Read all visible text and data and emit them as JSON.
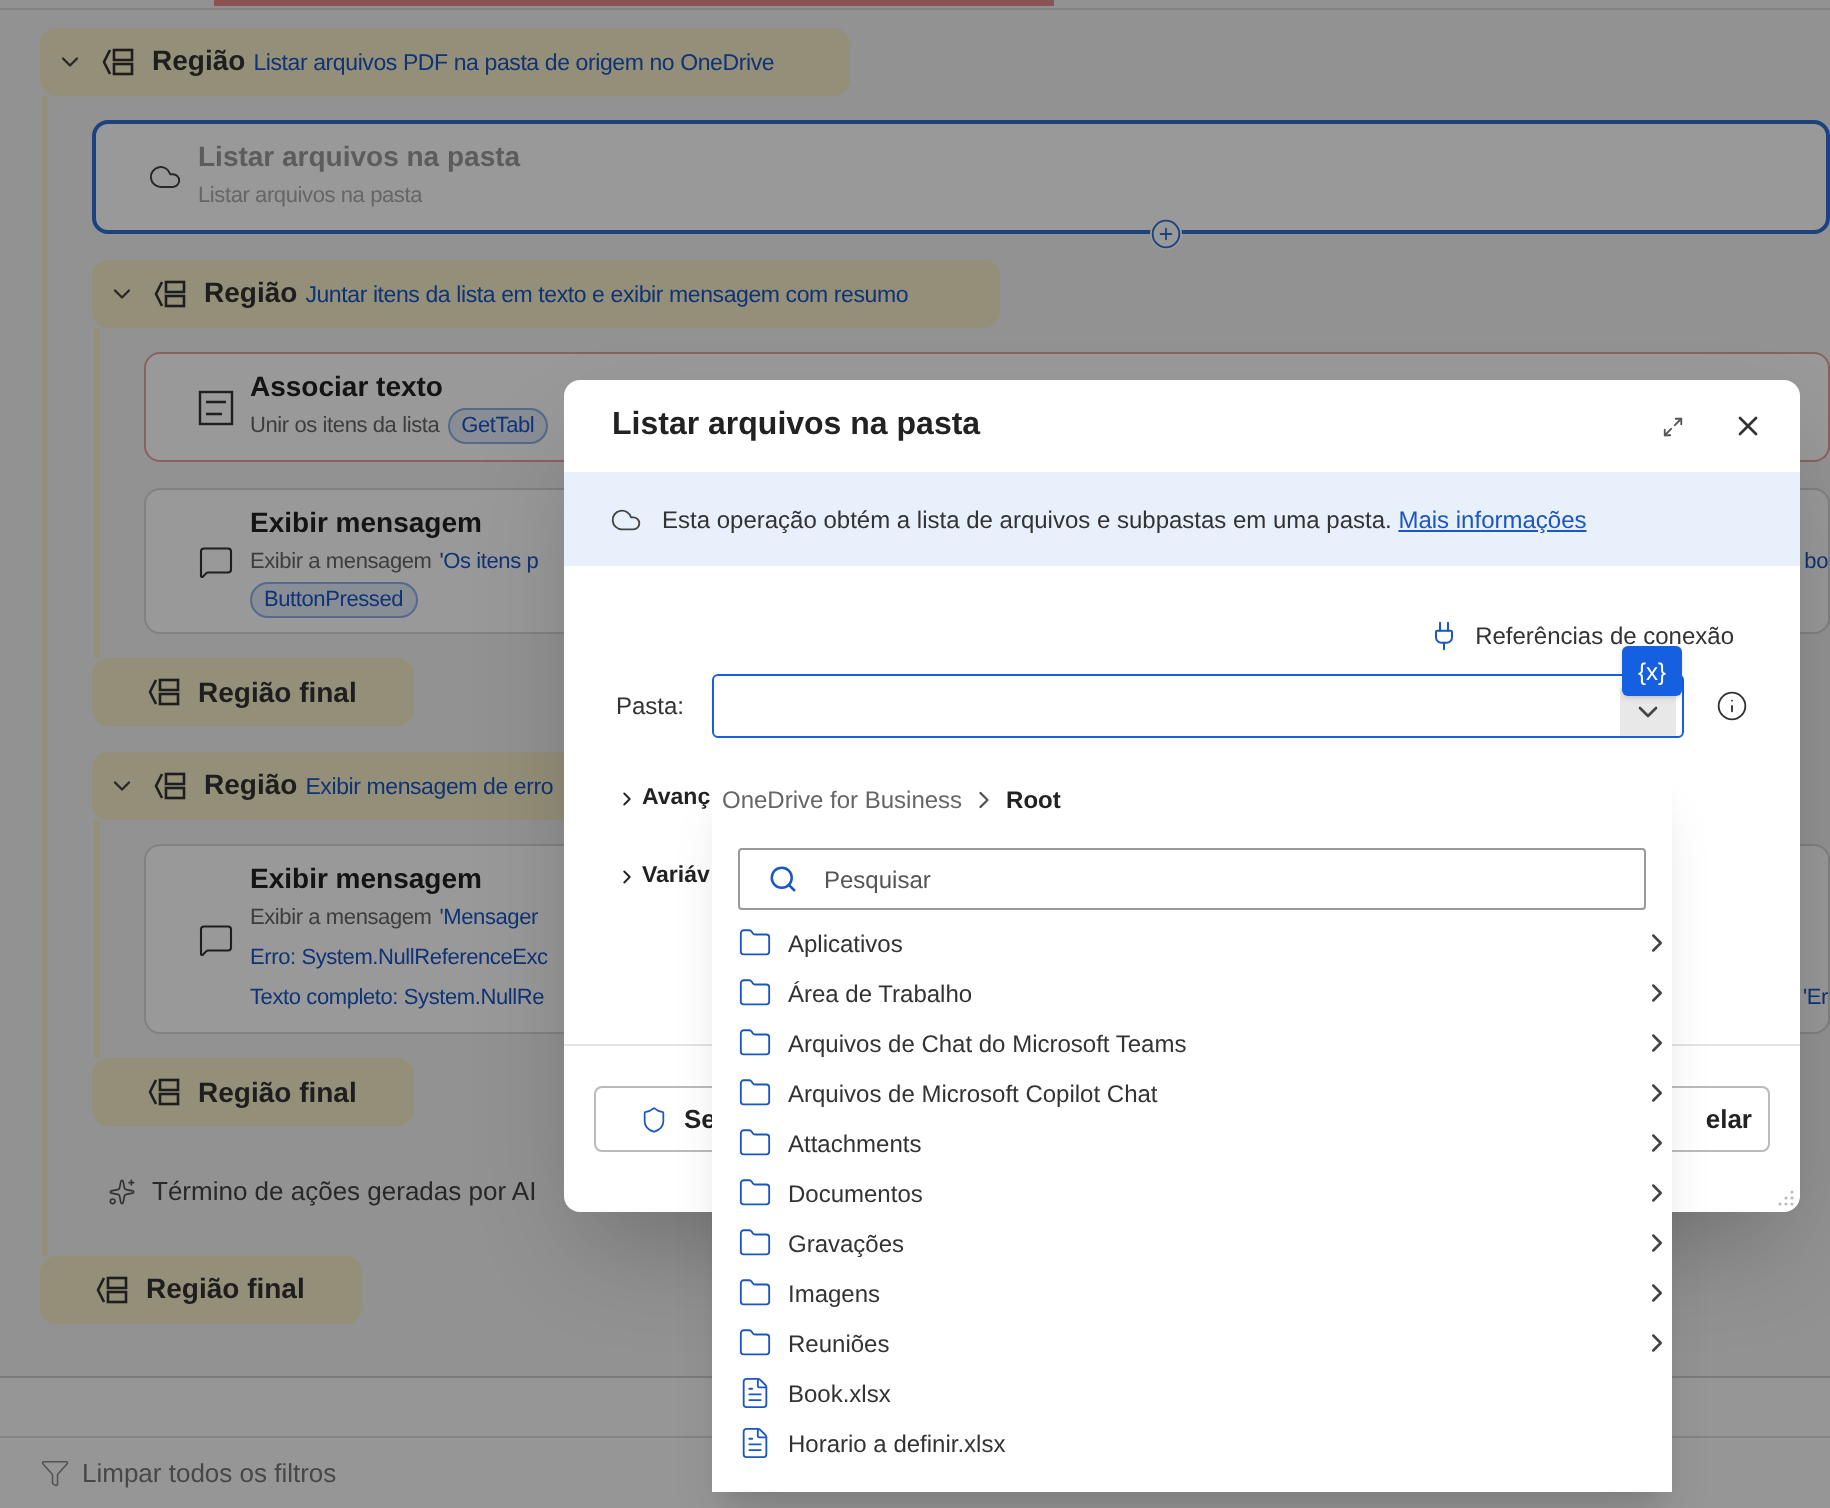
{
  "flow": [
    {
      "kind": "region",
      "label": "Região",
      "title": "Listar arquivos PDF na pasta de origem no OneDrive",
      "expanded": true,
      "end_label": "Região final",
      "children": [
        {
          "kind": "listfiles",
          "title": "Listar arquivos na pasta",
          "selected": true,
          "error": false,
          "disabled": true,
          "lines": [
            [
              {
                "kind": "plain",
                "text": "Listar arquivos na pasta"
              }
            ]
          ]
        },
        {
          "kind": "region",
          "label": "Região",
          "title": "Juntar itens da lista em texto e exibir mensagem com resumo",
          "expanded": true,
          "end_label": "Região final",
          "children": [
            {
              "kind": "jointext",
              "title": "Associar texto",
              "selected": false,
              "error": true,
              "disabled": false,
              "lines": [
                [
                  {
                    "kind": "plain",
                    "text": "Unir os itens da lista"
                  },
                  {
                    "kind": "token",
                    "text": "GetTabl"
                  }
                ]
              ]
            },
            {
              "kind": "message",
              "title": "Exibir mensagem",
              "selected": false,
              "error": false,
              "disabled": false,
              "lines": [
                [
                  {
                    "kind": "plain",
                    "text": "Exibir a mensagem"
                  },
                  {
                    "kind": "var",
                    "text": "'Os itens p"
                  },
                  {
                    "kind": "tail",
                    "text": "bo"
                  }
                ],
                [
                  {
                    "kind": "token",
                    "text": "ButtonPressed"
                  }
                ]
              ]
            }
          ]
        },
        {
          "kind": "region",
          "label": "Região",
          "title": "Exibir mensagem de erro",
          "expanded": true,
          "end_label": "Região final",
          "children": [
            {
              "kind": "message",
              "title": "Exibir mensagem",
              "selected": false,
              "error": false,
              "disabled": false,
              "lines": [
                [
                  {
                    "kind": "plain",
                    "text": "Exibir a mensagem"
                  },
                  {
                    "kind": "var",
                    "text": "'Mensager"
                  }
                ],
                [
                  {
                    "kind": "var",
                    "text": "Erro: System.NullReferenceExc"
                  }
                ],
                [
                  {
                    "kind": "var",
                    "text": "Texto completo: System.NullRe"
                  },
                  {
                    "kind": "tail",
                    "text": "'Er"
                  }
                ]
              ]
            }
          ]
        },
        {
          "kind": "note",
          "text": "Término de ações geradas por AI"
        }
      ]
    }
  ],
  "bottom_bar": {
    "clear_filters": "Limpar todos os filtros"
  },
  "dialog": {
    "title": "Listar arquivos na pasta",
    "banner": {
      "text": "Esta operação obtém a lista de arquivos e subpastas em uma pasta.",
      "link": "Mais informações"
    },
    "connection_refs": "Referências de conexão",
    "variable_button": "{x}",
    "field": {
      "label": "Pasta:"
    },
    "sections": [
      {
        "label": "Avanç",
        "expanded": false
      },
      {
        "label": "Variáv",
        "expanded": false
      }
    ],
    "footer": {
      "left_button": "Se",
      "right_button": "elar"
    }
  },
  "dropdown": {
    "breadcrumb": [
      {
        "text": "OneDrive for Business",
        "current": false
      },
      {
        "text": "Root",
        "current": true
      }
    ],
    "search": {
      "placeholder": "Pesquisar"
    },
    "items": [
      {
        "kind": "folder",
        "name": "Aplicativos"
      },
      {
        "kind": "folder",
        "name": "Área de Trabalho"
      },
      {
        "kind": "folder",
        "name": "Arquivos de Chat do Microsoft Teams"
      },
      {
        "kind": "folder",
        "name": "Arquivos de Microsoft Copilot Chat"
      },
      {
        "kind": "folder",
        "name": "Attachments"
      },
      {
        "kind": "folder",
        "name": "Documentos"
      },
      {
        "kind": "folder",
        "name": "Gravações"
      },
      {
        "kind": "folder",
        "name": "Imagens"
      },
      {
        "kind": "folder",
        "name": "Reuniões"
      },
      {
        "kind": "file",
        "name": "Book.xlsx"
      },
      {
        "kind": "file",
        "name": "Horario a definir.xlsx"
      }
    ]
  }
}
